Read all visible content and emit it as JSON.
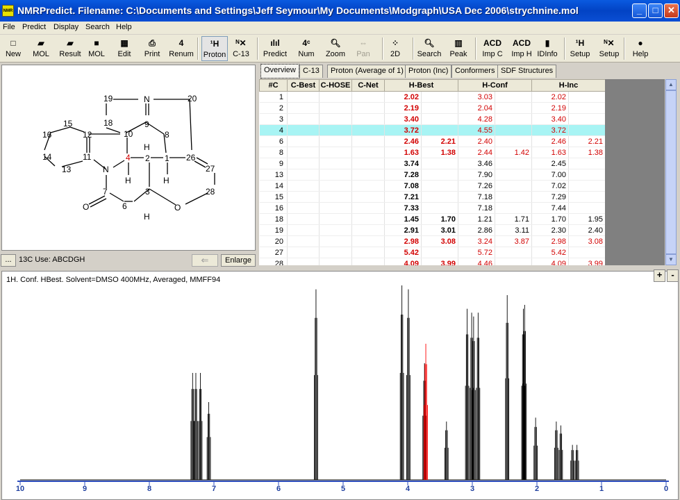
{
  "window": {
    "title": "NMRPredict. Filename: C:\\Documents and Settings\\Jeff Seymour\\My Documents\\Modgraph\\USA Dec 2006\\strychnine.mol",
    "icon_text": "NMR"
  },
  "menu": [
    "File",
    "Predict",
    "Display",
    "Search",
    "Help"
  ],
  "toolbar": [
    {
      "label": "New",
      "icon": "new-document-icon",
      "glyph": "□"
    },
    {
      "label": "MOL",
      "icon": "open-folder-icon",
      "glyph": "▰"
    },
    {
      "label": "Result",
      "icon": "open-result-icon",
      "glyph": "▰"
    },
    {
      "label": "MOL",
      "icon": "save-disk-icon",
      "glyph": "■"
    },
    {
      "label": "Edit",
      "icon": "edit-icon",
      "glyph": "▦"
    },
    {
      "label": "Print",
      "icon": "printer-icon",
      "glyph": "⎙"
    },
    {
      "label": "Renum",
      "icon": "renumber-icon",
      "glyph": "4"
    },
    {
      "label": "Proton",
      "icon": "proton-icon",
      "glyph": "¹H",
      "pressed": true
    },
    {
      "label": "C-13",
      "icon": "c13-icon",
      "glyph": "ᴺ✕"
    },
    {
      "label": "Predict",
      "icon": "predict-spectrum-icon",
      "glyph": "ılıl"
    },
    {
      "label": "Num",
      "icon": "numbering-icon",
      "glyph": "4ᶜ"
    },
    {
      "label": "Zoom",
      "icon": "zoom-magnifier-icon",
      "glyph": "🔍︎"
    },
    {
      "label": "Pan",
      "icon": "pan-icon",
      "glyph": "⇔",
      "disabled": true
    },
    {
      "label": "2D",
      "icon": "2d-icon",
      "glyph": "⁘"
    },
    {
      "label": "Search",
      "icon": "search-icon",
      "glyph": "🔍︎"
    },
    {
      "label": "Peak",
      "icon": "peak-icon",
      "glyph": "▥"
    },
    {
      "label": "Imp C",
      "icon": "acd-labs-import-c-icon",
      "glyph": "ACD"
    },
    {
      "label": "Imp H",
      "icon": "acd-labs-import-h-icon",
      "glyph": "ACD"
    },
    {
      "label": "IDInfo",
      "icon": "idinfo-icon",
      "glyph": "▮"
    },
    {
      "label": "Setup",
      "icon": "setup-proton-icon",
      "glyph": "¹H"
    },
    {
      "label": "Setup",
      "icon": "setup-c13-icon",
      "glyph": "ᴺ✕"
    },
    {
      "label": "Help",
      "icon": "help-globe-icon",
      "glyph": "●"
    }
  ],
  "tabs": [
    "Overview",
    "C-13",
    "Proton (Average of 1)",
    "Proton (Inc)",
    "Conformers",
    "SDF Structures"
  ],
  "active_tab": 0,
  "grid": {
    "headers": [
      "#C",
      "C-Best",
      "C-HOSE",
      "C-Net",
      "H-Best",
      "H-Conf",
      "H-Inc"
    ],
    "rows": [
      {
        "c": "1",
        "hb1": "2.02",
        "hb2": "",
        "hc1": "3.03",
        "hc2": "",
        "hi1": "2.02",
        "hi2": "",
        "red": true
      },
      {
        "c": "2",
        "hb1": "2.19",
        "hb2": "",
        "hc1": "2.04",
        "hc2": "",
        "hi1": "2.19",
        "hi2": "",
        "red": true
      },
      {
        "c": "3",
        "hb1": "3.40",
        "hb2": "",
        "hc1": "4.28",
        "hc2": "",
        "hi1": "3.40",
        "hi2": "",
        "red": true
      },
      {
        "c": "4",
        "hb1": "3.72",
        "hb2": "",
        "hc1": "4.55",
        "hc2": "",
        "hi1": "3.72",
        "hi2": "",
        "red": true,
        "selected": true
      },
      {
        "c": "6",
        "hb1": "2.46",
        "hb2": "2.21",
        "hc1": "2.40",
        "hc2": "",
        "hi1": "2.46",
        "hi2": "2.21",
        "red": true
      },
      {
        "c": "8",
        "hb1": "1.63",
        "hb2": "1.38",
        "hc1": "2.44",
        "hc2": "1.42",
        "hi1": "1.63",
        "hi2": "1.38",
        "red": true
      },
      {
        "c": "9",
        "hb1": "3.74",
        "hb2": "",
        "hc1": "3.46",
        "hc2": "",
        "hi1": "2.45",
        "hi2": "",
        "red": false
      },
      {
        "c": "13",
        "hb1": "7.28",
        "hb2": "",
        "hc1": "7.90",
        "hc2": "",
        "hi1": "7.00",
        "hi2": "",
        "red": false
      },
      {
        "c": "14",
        "hb1": "7.08",
        "hb2": "",
        "hc1": "7.26",
        "hc2": "",
        "hi1": "7.02",
        "hi2": "",
        "red": false
      },
      {
        "c": "15",
        "hb1": "7.21",
        "hb2": "",
        "hc1": "7.18",
        "hc2": "",
        "hi1": "7.29",
        "hi2": "",
        "red": false
      },
      {
        "c": "16",
        "hb1": "7.33",
        "hb2": "",
        "hc1": "7.18",
        "hc2": "",
        "hi1": "7.44",
        "hi2": "",
        "red": false
      },
      {
        "c": "18",
        "hb1": "1.45",
        "hb2": "1.70",
        "hc1": "1.21",
        "hc2": "1.71",
        "hi1": "1.70",
        "hi2": "1.95",
        "red": false
      },
      {
        "c": "19",
        "hb1": "2.91",
        "hb2": "3.01",
        "hc1": "2.86",
        "hc2": "3.11",
        "hi1": "2.30",
        "hi2": "2.40",
        "red": false
      },
      {
        "c": "20",
        "hb1": "2.98",
        "hb2": "3.08",
        "hc1": "3.24",
        "hc2": "3.87",
        "hi1": "2.98",
        "hi2": "3.08",
        "red": true
      },
      {
        "c": "27",
        "hb1": "5.42",
        "hb2": "",
        "hc1": "5.72",
        "hc2": "",
        "hi1": "5.42",
        "hi2": "",
        "red": true
      },
      {
        "c": "28",
        "hb1": "4.09",
        "hb2": "3.99",
        "hc1": "4.46",
        "hc2": "",
        "hi1": "4.09",
        "hi2": "3.99",
        "red": true
      }
    ]
  },
  "molecule": {
    "atoms": [
      "19",
      "N",
      "20",
      "18",
      "9",
      "15",
      "10",
      "8",
      "16",
      "12",
      "H",
      "H",
      "14",
      "11",
      "4",
      "2",
      "1",
      "26",
      "27",
      "13",
      "N",
      "H",
      "H",
      "7",
      "3",
      "28",
      "O",
      "6",
      "O",
      "H"
    ]
  },
  "bottom_bar": {
    "dots": "...",
    "use_label": "13C Use: ABCDGH",
    "back_arrow": "⇐",
    "enlarge": "Enlarge"
  },
  "spectrum": {
    "title": "1H. Conf. HBest. Solvent=DMSO 400MHz, Averaged, MMFF94",
    "zoom_in": "+",
    "zoom_out": "-",
    "axis_ticks": [
      "10",
      "9",
      "8",
      "7",
      "6",
      "5",
      "4",
      "3",
      "2",
      "1",
      "0"
    ],
    "peak_color": "#000000",
    "highlight_color": "#ff0000",
    "highlight_ppm": 3.72,
    "peaks": [
      {
        "ppm": 7.33,
        "h": 0.55
      },
      {
        "ppm": 7.28,
        "h": 0.55
      },
      {
        "ppm": 7.21,
        "h": 0.55
      },
      {
        "ppm": 7.08,
        "h": 0.4
      },
      {
        "ppm": 5.42,
        "h": 0.98
      },
      {
        "ppm": 4.09,
        "h": 1.0
      },
      {
        "ppm": 3.99,
        "h": 0.98
      },
      {
        "ppm": 3.74,
        "h": 0.6
      },
      {
        "ppm": 3.72,
        "h": 0.7,
        "red": true
      },
      {
        "ppm": 3.4,
        "h": 0.3
      },
      {
        "ppm": 3.08,
        "h": 0.88
      },
      {
        "ppm": 3.01,
        "h": 0.86
      },
      {
        "ppm": 2.98,
        "h": 0.84
      },
      {
        "ppm": 2.91,
        "h": 0.86
      },
      {
        "ppm": 2.46,
        "h": 0.95
      },
      {
        "ppm": 2.21,
        "h": 0.88
      },
      {
        "ppm": 2.19,
        "h": 0.9
      },
      {
        "ppm": 2.02,
        "h": 0.32
      },
      {
        "ppm": 1.7,
        "h": 0.3
      },
      {
        "ppm": 1.63,
        "h": 0.28
      },
      {
        "ppm": 1.45,
        "h": 0.18
      },
      {
        "ppm": 1.38,
        "h": 0.18
      }
    ]
  }
}
